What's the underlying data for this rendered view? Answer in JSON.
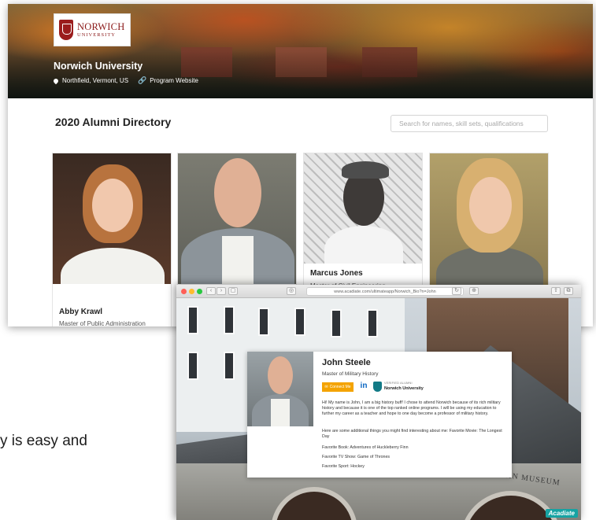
{
  "directory": {
    "logo": {
      "main": "NORWICH",
      "sub": "UNIVERSITY"
    },
    "university_name": "Norwich University",
    "location": "Northfield, Vermont, US",
    "program_link": "Program Website",
    "title": "2020 Alumni Directory",
    "search_placeholder": "Search for names, skill sets, qualifications",
    "cards": [
      {
        "name": "Abby Krawl",
        "degree": "Master of Public Administration"
      },
      {
        "name": "",
        "degree": ""
      },
      {
        "name": "Marcus Jones",
        "degree": "Master of Civil Engineering"
      },
      {
        "name": "",
        "degree": ""
      }
    ]
  },
  "browser": {
    "url": "www.acadiate.com/ultimateapp/Norwich_Bio?n=John"
  },
  "profile": {
    "name": "John Steele",
    "degree": "Master of Military History",
    "connect_label": "Connect Me",
    "linkedin_glyph": "in",
    "verified_label": "VERIFIED ALUMNI",
    "verified_school": "Norwich University",
    "bio": "Hi! My name is John, I am a big history buff! I chose to attend Norwich because of its rich military history and because it is one of the top ranked online programs. I will be using my education to further my career as a teacher and hope to one day become a professor of military history.",
    "interesting": "Here are some additional things you might find interesting about me: Favorite Movie: The Longest Day",
    "book": "Favorite Book: Adventures of Huckleberry Finn",
    "tv": "Favorite TV Show: Game of Thrones",
    "sport": "Favorite Sport: Hockey"
  },
  "scene": {
    "sign": "SULLIVAN MUSEUM",
    "watermark": "Acadiate"
  },
  "caption": "y is easy and",
  "colors": {
    "brand_red": "#8b1a1a",
    "connect_orange": "#f4a300",
    "linkedin_blue": "#0a66c2",
    "verified_teal": "#127a86",
    "acadiate_teal": "#16a3a3"
  }
}
